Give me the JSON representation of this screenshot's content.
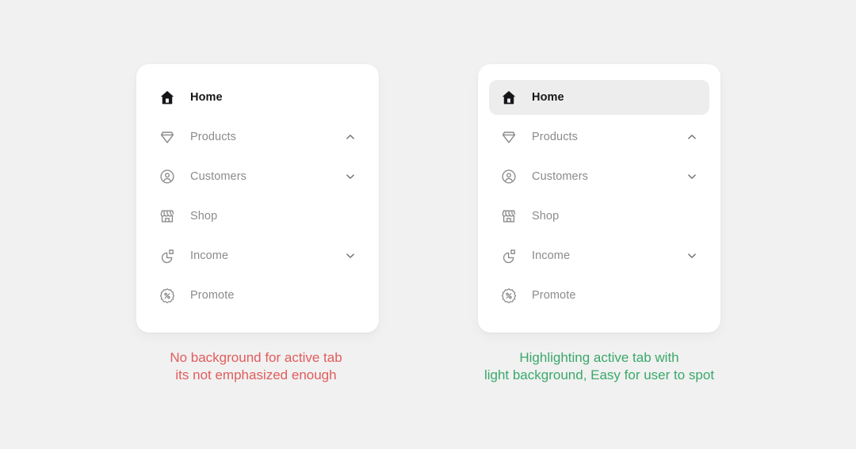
{
  "page": {
    "background_color": "#f1f1f1"
  },
  "examples": [
    {
      "id": "without-highlight",
      "variant": "plain",
      "card": {
        "background_color": "#ffffff"
      },
      "nav": {
        "items": [
          {
            "label": "Home",
            "icon": "home-icon",
            "state": "active",
            "chevron": "none"
          },
          {
            "label": "Products",
            "icon": "diamond-icon",
            "state": "idle",
            "chevron": "chevron-up-icon"
          },
          {
            "label": "Customers",
            "icon": "user-circle-icon",
            "state": "idle",
            "chevron": "chevron-down-icon"
          },
          {
            "label": "Shop",
            "icon": "storefront-icon",
            "state": "idle",
            "chevron": "none"
          },
          {
            "label": "Income",
            "icon": "pie-chart-icon",
            "state": "idle",
            "chevron": "chevron-down-icon"
          },
          {
            "label": "Promote",
            "icon": "percent-badge-icon",
            "state": "idle",
            "chevron": "none"
          }
        ]
      },
      "caption": {
        "color": "#e25c5c",
        "line1": "No background for active tab",
        "line2": "its not emphasized enough"
      }
    },
    {
      "id": "with-highlight",
      "variant": "pill",
      "card": {
        "background_color": "#ffffff",
        "active_pill_color": "#ededed"
      },
      "nav": {
        "items": [
          {
            "label": "Home",
            "icon": "home-icon",
            "state": "active",
            "chevron": "none"
          },
          {
            "label": "Products",
            "icon": "diamond-icon",
            "state": "idle",
            "chevron": "chevron-up-icon"
          },
          {
            "label": "Customers",
            "icon": "user-circle-icon",
            "state": "idle",
            "chevron": "chevron-down-icon"
          },
          {
            "label": "Shop",
            "icon": "storefront-icon",
            "state": "idle",
            "chevron": "none"
          },
          {
            "label": "Income",
            "icon": "pie-chart-icon",
            "state": "idle",
            "chevron": "chevron-down-icon"
          },
          {
            "label": "Promote",
            "icon": "percent-badge-icon",
            "state": "idle",
            "chevron": "none"
          }
        ]
      },
      "caption": {
        "color": "#3aa86b",
        "line1": "Highlighting active tab with",
        "line2": "light background, Easy for user to spot"
      }
    }
  ]
}
